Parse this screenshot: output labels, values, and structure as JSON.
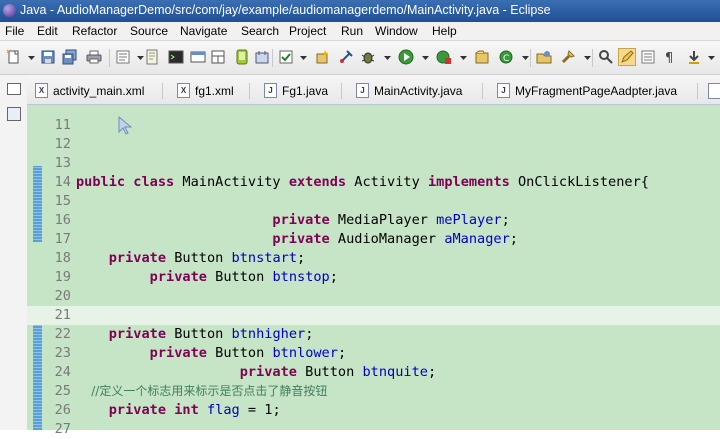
{
  "window": {
    "title": "Java - AudioManagerDemo/src/com/jay/example/audiomanagerdemo/MainActivity.java - Eclipse"
  },
  "menu": [
    "File",
    "Edit",
    "Refactor",
    "Source",
    "Navigate",
    "Search",
    "Project",
    "Run",
    "Window",
    "Help"
  ],
  "tabs": [
    {
      "label": "activity_main.xml",
      "icon": "xml-file-icon"
    },
    {
      "label": "fg1.xml",
      "icon": "xml-file-icon"
    },
    {
      "label": "Fg1.java",
      "icon": "java-file-icon"
    },
    {
      "label": "MainActivity.java",
      "icon": "java-file-icon"
    },
    {
      "label": "MyFragmentPageAadpter.java",
      "icon": "java-file-icon"
    }
  ],
  "editor": {
    "lines": [
      {
        "n": "11",
        "code": ""
      },
      {
        "n": "12",
        "code": ""
      },
      {
        "n": "13",
        "code": ""
      },
      {
        "n": "14",
        "code": "public class MainActivity extends Activity implements OnClickListener{"
      },
      {
        "n": "15",
        "code": ""
      },
      {
        "n": "16",
        "code": "                        private MediaPlayer mePlayer;"
      },
      {
        "n": "17",
        "code": "                        private AudioManager aManager;"
      },
      {
        "n": "18",
        "code": "    private Button btnstart;"
      },
      {
        "n": "19",
        "code": "         private Button btnstop;"
      },
      {
        "n": "20",
        "code": ""
      },
      {
        "n": "21",
        "code": ""
      },
      {
        "n": "22",
        "code": "    private Button btnhigher;"
      },
      {
        "n": "23",
        "code": "         private Button btnlower;"
      },
      {
        "n": "24",
        "code": "                    private Button btnquite;"
      },
      {
        "n": "25",
        "code": "    //定义一个标志用来标示是否点击了静音按钮"
      },
      {
        "n": "26",
        "code": "    private int flag = 1;"
      },
      {
        "n": "27",
        "code": ""
      }
    ],
    "current_line": "21"
  }
}
